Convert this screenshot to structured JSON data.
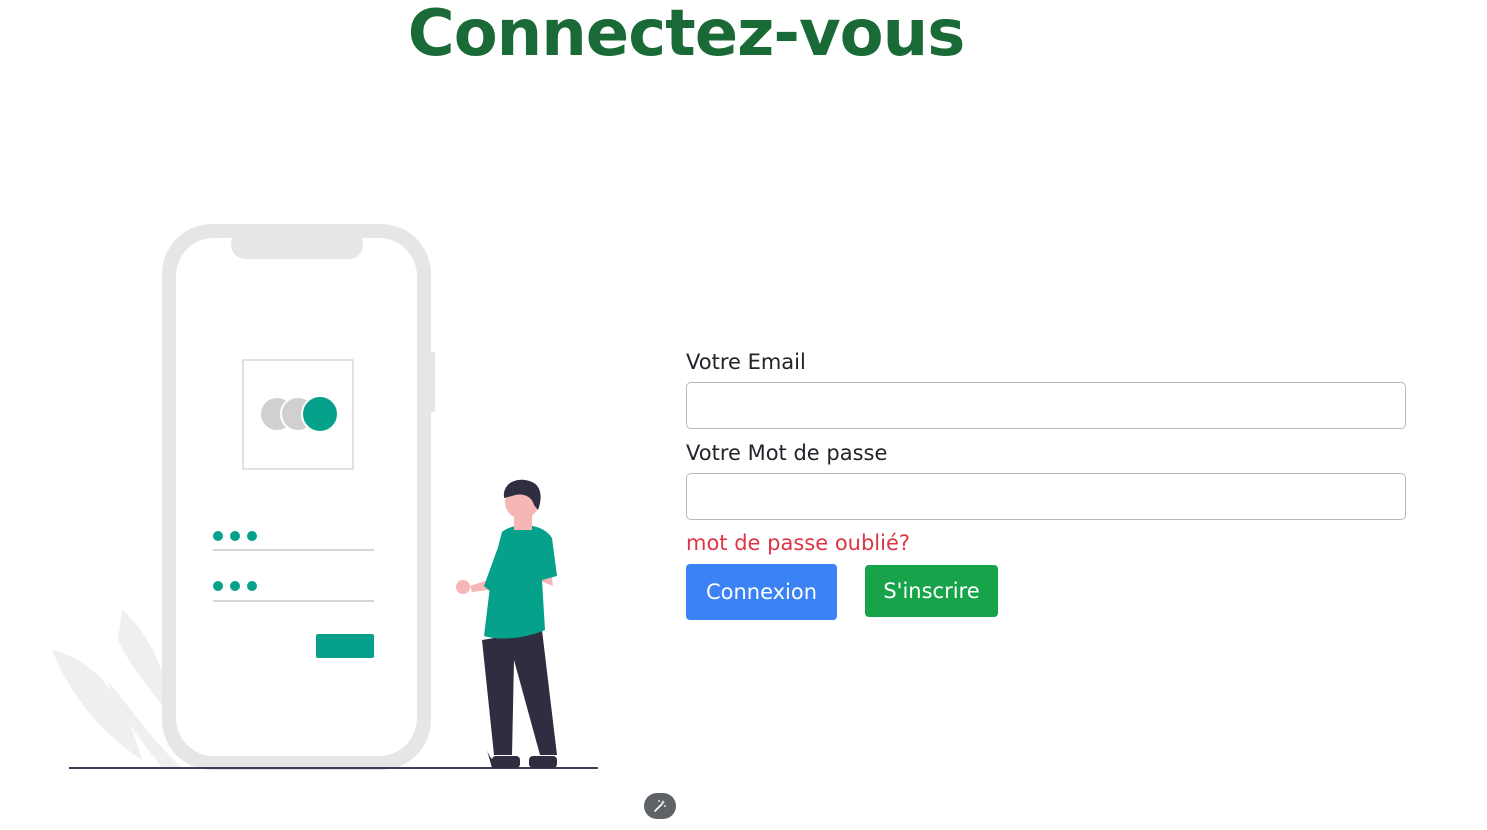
{
  "header": {
    "title": "Connectez-vous"
  },
  "form": {
    "email_label": "Votre Email",
    "email_value": "",
    "password_label": "Votre Mot de passe",
    "password_value": "",
    "forgot_link": "mot de passe oublié?",
    "login_button": "Connexion",
    "signup_button": "S'inscrire"
  },
  "colors": {
    "title": "#1a6a38",
    "login_button": "#3b82f6",
    "signup_button": "#16a34a",
    "forgot_link": "#dc3545",
    "accent": "#06a18a"
  },
  "icons": {
    "floating_button": "magic-wand-icon"
  }
}
